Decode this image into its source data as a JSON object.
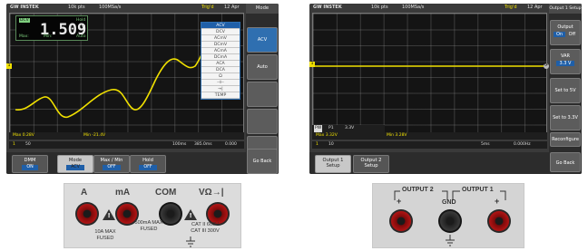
{
  "left_screen": {
    "topbar": {
      "brand": "GW INSTEK",
      "timebase": "10k pts",
      "sample_rate": "100MSa/s",
      "trigger": "Trig'd",
      "date": "12 Apr"
    },
    "sidebar": {
      "title": "Mode",
      "buttons": [
        "ACV",
        "Auto",
        "",
        "",
        "",
        "",
        "Go Back"
      ]
    },
    "dmm_display": {
      "mode_tag": "DCV",
      "value": "1.509",
      "unit": "V",
      "hold": "Hold",
      "range": "Auto",
      "min_label": "Max:",
      "max_label": "Min:"
    },
    "dropdown": {
      "items": [
        "ACV",
        "DCV",
        "ACmV",
        "DCmV",
        "ACmA",
        "DCmA",
        "ACA",
        "DCA",
        "Ω",
        "⊣⊢",
        "→|",
        "TEMP"
      ],
      "selected": "ACV"
    },
    "status": {
      "max": "Max 0.28V",
      "min": "Min -21.4V",
      "ch": "1",
      "scale": "50",
      "time": "100ms",
      "time2": "385.0ms",
      "freq": "0.000"
    },
    "bottom": [
      {
        "label": "DMM",
        "value": "ON"
      },
      {
        "label": "Mode",
        "value": "ACV"
      },
      {
        "label": "Max / Min",
        "value": "OFF"
      },
      {
        "label": "Hold",
        "value": "OFF"
      }
    ]
  },
  "right_screen": {
    "topbar": {
      "brand": "GW INSTEK",
      "timebase": "10k pts",
      "sample_rate": "100MSa/s",
      "trigger": "Trig'd",
      "date": "12 Apr"
    },
    "sidebar": {
      "title": "Output 1 Setup",
      "output_label": "Output",
      "output_on": "On",
      "output_off": "Off",
      "var_label": "VAR",
      "var_value": "3.3 V",
      "set5": "Set to 5V",
      "set33": "Set to 3.3V",
      "reconfig": "Reconfigure",
      "go_back": "Go Back"
    },
    "status": {
      "pw": "PW",
      "ch1": "P1",
      "v": "3.3V",
      "max": "Max 3.32V",
      "min": "Min 3.28V",
      "scale": "10",
      "time": "5ms",
      "freq": "0.000Hz"
    },
    "bottom": [
      {
        "label": "Output 1",
        "value": "Setup"
      },
      {
        "label": "Output 2",
        "value": "Setup"
      }
    ]
  },
  "left_panel": {
    "labels": [
      "A",
      "mA",
      "COM",
      "VΩ→|"
    ],
    "fuse_text": [
      "10A MAX",
      "FUSED"
    ],
    "fuse2_text": [
      "500mA MAX",
      "FUSED"
    ],
    "cat_text": [
      "CAT II 600V",
      "CAT III 300V"
    ]
  },
  "right_panel": {
    "output2": "OUTPUT 2",
    "output1": "OUTPUT 1",
    "gnd": "GND",
    "plus1": "+",
    "plus2": "+"
  },
  "colors": {
    "trace": "#f0e000",
    "accent_blue": "#1f5fa8",
    "jack_red": "#b01414"
  }
}
